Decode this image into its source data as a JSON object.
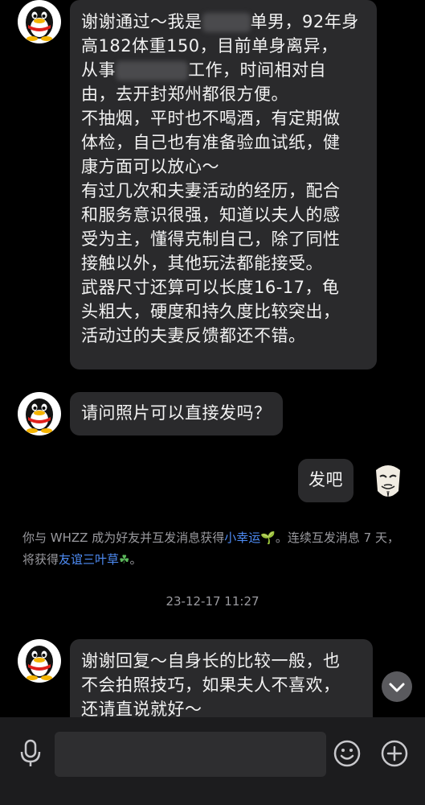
{
  "messages": {
    "m1": {
      "line1_a": "谢谢通过～我是",
      "line1_b": "单男，92年身",
      "line2": "高182体重150，目前单身离异，",
      "line3_a": "从事",
      "line3_b": "工作，时间相对自",
      "line4": "由，去开封郑州都很方便。",
      "line5": "不抽烟，平时也不喝酒，有定期做",
      "line6": "体检，自己也有准备验血试纸，健",
      "line7": "康方面可以放心～",
      "line8": "有过几次和夫妻活动的经历，配合",
      "line9": "和服务意识很强，知道以夫人的感",
      "line10": "受为主，懂得克制自己，除了同性",
      "line11": "接触以外，其他玩法都能接受。",
      "line12": "武器尺寸还算可以长度16-17，龟",
      "line13": "头粗大，硬度和持久度比较突出，",
      "line14": "活动过的夫妻反馈都还不错。"
    },
    "m2": "请问照片可以直接发吗？",
    "m3": "发吧",
    "m4": {
      "line1": "谢谢回复～自身长的比较一般，也",
      "line2": "不会拍照技巧，如果夫人不喜欢，",
      "line3": "还请直说就好～"
    }
  },
  "system_notice": {
    "part1": "你与 WHZZ 成为好友并互发消息获得",
    "link1": "小幸运",
    "part2": "。连续互发消息 7 天，将获得",
    "link2": "友谊三叶草",
    "part3": "。"
  },
  "timestamp": "23-12-17 11:27",
  "colors": {
    "background": "#000000",
    "bubble": "#2a2a2c",
    "link": "#4e8cf5",
    "system_text": "#9a9a9f"
  },
  "icons": {
    "voice": "microphone-icon",
    "emoji": "smiley-icon",
    "more": "plus-circle-icon",
    "scroll": "chevron-down-icon"
  }
}
